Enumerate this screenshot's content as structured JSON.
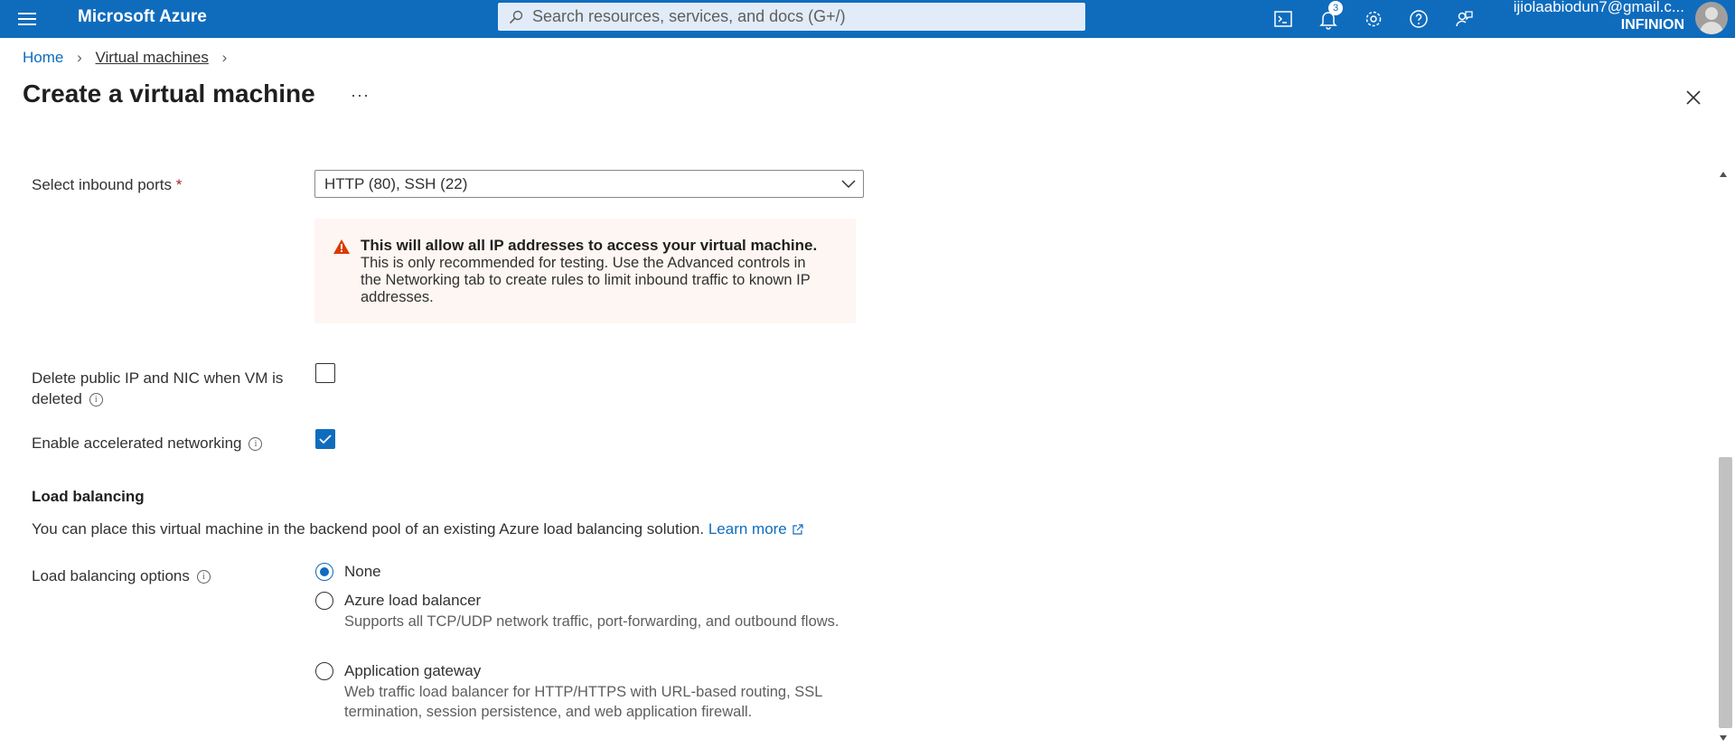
{
  "header": {
    "brand": "Microsoft Azure",
    "search_placeholder": "Search resources, services, and docs (G+/)",
    "notifications_count": "3",
    "account_email": "ijiolaabiodun7@gmail.c...",
    "account_tenant": "INFINION",
    "icons": [
      "cloud-shell-icon",
      "notifications-icon",
      "settings-icon",
      "help-icon",
      "feedback-icon"
    ]
  },
  "breadcrumb": {
    "home": "Home",
    "virtual_machines": "Virtual machines"
  },
  "page": {
    "title": "Create a virtual machine",
    "more": "···"
  },
  "form": {
    "inbound_ports_label": "Select inbound ports",
    "required_mark": "*",
    "inbound_ports_value": "HTTP (80), SSH (22)",
    "warning_title": "This will allow all IP addresses to access your virtual machine.",
    "warning_body": "This is only recommended for testing.  Use the Advanced controls in the Networking tab to create rules to limit inbound traffic to known IP addresses.",
    "delete_ip_label_line1": "Delete public IP and NIC when VM is",
    "delete_ip_label_line2": "deleted",
    "delete_ip_checked": false,
    "accel_net_label": "Enable accelerated networking",
    "accel_net_checked": true
  },
  "load_balancing": {
    "section_title": "Load balancing",
    "description": "You can place this virtual machine in the backend pool of an existing Azure load balancing solution.",
    "learn_more": "Learn more",
    "options_label": "Load balancing options",
    "selected": "None",
    "options": [
      {
        "label": "None",
        "description": ""
      },
      {
        "label": "Azure load balancer",
        "description": "Supports all TCP/UDP network traffic, port-forwarding, and outbound flows."
      },
      {
        "label": "Application gateway",
        "description": "Web traffic load balancer for HTTP/HTTPS with URL-based routing, SSL termination, session persistence, and web application firewall."
      }
    ]
  },
  "colors": {
    "accent": "#0f6cbd",
    "warning_bg": "#fdf6f3",
    "warning_icon": "#d83b01"
  }
}
